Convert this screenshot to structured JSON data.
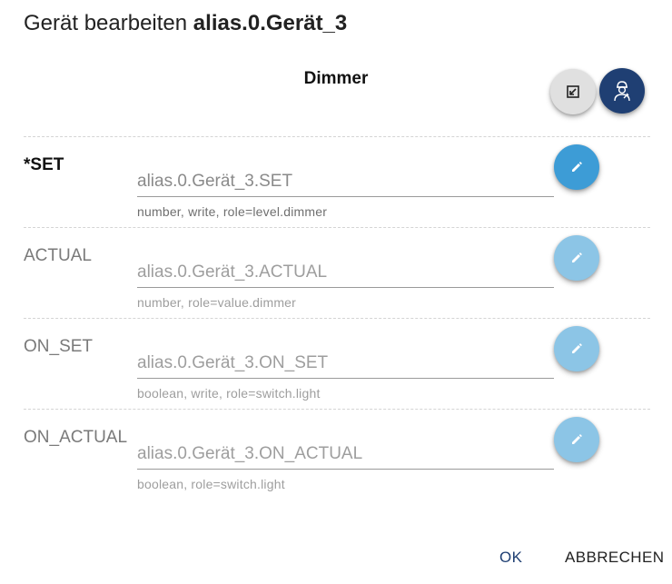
{
  "dialog": {
    "title_prefix": "Gerät bearbeiten",
    "title_id": "alias.0.Gerät_3",
    "device_type": "Dimmer"
  },
  "colors": {
    "primary": "#1f3f73",
    "edit_active": "#3d9cd6",
    "edit_inactive": "#8cc5e6"
  },
  "icons": {
    "expand": "expand-icon",
    "expert": "expert-worker-icon",
    "edit": "pencil-icon"
  },
  "states": [
    {
      "name": "*SET",
      "placeholder": "alias.0.Gerät_3.SET",
      "hint": "number, write, role=level.dimmer",
      "required": true
    },
    {
      "name": "ACTUAL",
      "placeholder": "alias.0.Gerät_3.ACTUAL",
      "hint": "number, role=value.dimmer",
      "required": false
    },
    {
      "name": "ON_SET",
      "placeholder": "alias.0.Gerät_3.ON_SET",
      "hint": "boolean, write, role=switch.light",
      "required": false
    },
    {
      "name": "ON_ACTUAL",
      "placeholder": "alias.0.Gerät_3.ON_ACTUAL",
      "hint": "boolean, role=switch.light",
      "required": false
    }
  ],
  "actions": {
    "ok_label": "OK",
    "cancel_label": "ABBRECHEN"
  }
}
